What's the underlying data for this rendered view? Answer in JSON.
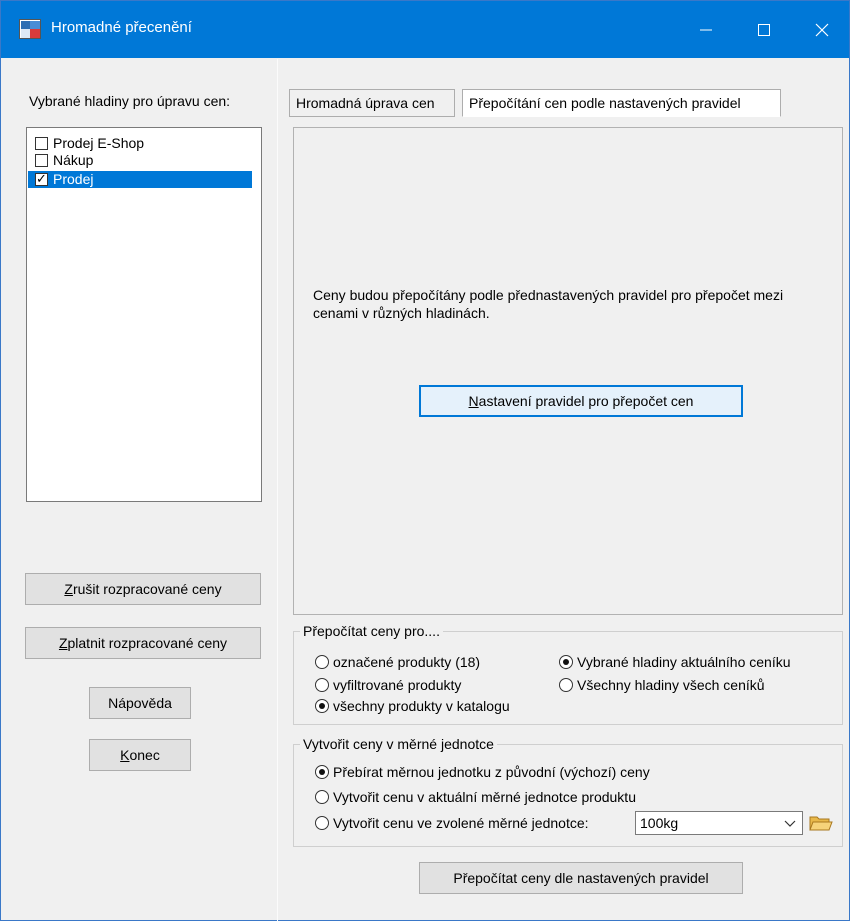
{
  "window": {
    "title": "Hromadné přecenění"
  },
  "left": {
    "label": "Vybrané hladiny pro úpravu cen:",
    "levels": [
      {
        "label": "Prodej E-Shop",
        "checked": false,
        "selected": false
      },
      {
        "label": "Nákup",
        "checked": false,
        "selected": false
      },
      {
        "label": "Prodej",
        "checked": true,
        "selected": true
      }
    ],
    "buttons": {
      "cancel_prefix": "Z",
      "cancel_rest": "rušit rozpracované ceny",
      "pay_prefix": "Z",
      "pay_rest": "platnit rozpracované ceny",
      "help": "Nápověda",
      "end_prefix": "K",
      "end_rest": "onec"
    }
  },
  "tabs": [
    {
      "label": "Hromadná úprava cen",
      "active": false
    },
    {
      "label": "Přepočítání cen podle nastavených pravidel",
      "active": true
    }
  ],
  "tab_page": {
    "info": "Ceny budou přepočítány podle přednastavených pravidel pro přepočet mezi cenami v různých hladinách.",
    "rules_button_prefix": "N",
    "rules_button_rest": "astavení pravidel pro přepočet cen"
  },
  "group_products": {
    "legend": "Přepočítat ceny pro....",
    "options": [
      {
        "label": "označené produkty (18)",
        "checked": false
      },
      {
        "label": "vyfiltrované produkty",
        "checked": false
      },
      {
        "label": "všechny produkty v katalogu",
        "checked": true
      }
    ],
    "scope_options": [
      {
        "label": "Vybrané hladiny aktuálního ceníku",
        "checked": true
      },
      {
        "label": "Všechny hladiny všech ceníků",
        "checked": false
      }
    ]
  },
  "group_unit": {
    "legend": "Vytvořit ceny v měrné jednotce",
    "options": [
      {
        "label": "Přebírat měrnou jednotku z původní (výchozí) ceny",
        "checked": true
      },
      {
        "label": "Vytvořit cenu v aktuální měrné jednotce produktu",
        "checked": false
      },
      {
        "label": "Vytvořit cenu ve zvolené měrné jednotce:",
        "checked": false
      }
    ],
    "unit_value": "100kg"
  },
  "bottom": {
    "recalc_button": "Přepočítat ceny dle nastavených pravidel"
  },
  "colors": {
    "titlebar": "#0078d7",
    "selection": "#0078d7",
    "window_bg": "#f0f0f0"
  },
  "icons": {
    "app": "app-icon",
    "minimize": "minimize-icon",
    "maximize": "maximize-icon",
    "close": "close-icon",
    "dropdown": "chevron-down-icon",
    "folder": "folder-icon"
  }
}
